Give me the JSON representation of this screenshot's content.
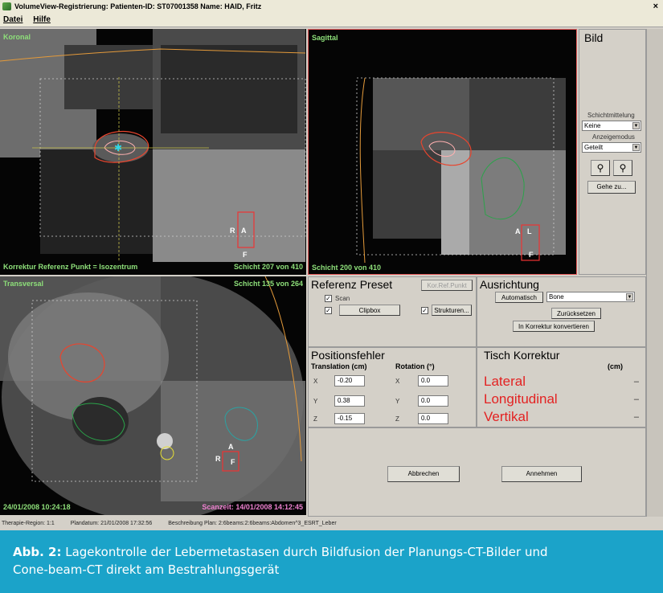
{
  "window": {
    "title": "VolumeView-Registrierung: Patienten-ID: ST07001358  Name: HAID, Fritz",
    "close_glyph": "×"
  },
  "menu": {
    "items": [
      "Datei",
      "Hilfe"
    ]
  },
  "views": {
    "koronal": {
      "name": "Koronal",
      "footer_left": "Korrektur Referenz Punkt = Isozentrum",
      "footer_right": "Schicht 207 von 410",
      "markers": [
        "R",
        "A",
        "F"
      ]
    },
    "sagittal": {
      "name": "Sagittal",
      "footer_left": "Schicht 200 von 410",
      "markers": [
        "A",
        "L",
        "F"
      ]
    },
    "transversal": {
      "name": "Transversal",
      "header_right": "Schicht 135 von 264",
      "footer_left": "24/01/2008 10:24:18",
      "footer_right": "Scanzeit: 14/01/2008 14:12:45",
      "markers": [
        "A",
        "R",
        "F"
      ]
    }
  },
  "bild": {
    "title": "Bild",
    "schichtmittelung_label": "Schichtmittelung",
    "schichtmittelung_value": "Keine",
    "anzeigemodus_label": "Anzeigemodus",
    "anzeigemodus_value": "Geteilt",
    "goto_label": "Gehe zu..."
  },
  "referenz": {
    "title": "Referenz Preset",
    "korr_button": "Kor.Ref.Punkt",
    "scan_label": "Scan",
    "clipbox_label": "Clipbox",
    "strukturen_label": "Strukturen..."
  },
  "ausrichtung": {
    "title": "Ausrichtung",
    "auto_button": "Automatisch",
    "mode_value": "Bone",
    "reset_button": "Zurücksetzen",
    "convert_button": "In Korrektur konvertieren"
  },
  "positionsfehler": {
    "title": "Positionsfehler",
    "translation_header": "Translation (cm)",
    "rotation_header": "Rotation (°)",
    "axes": [
      "X",
      "Y",
      "Z"
    ],
    "translation_values": [
      "-0.20",
      "0.38",
      "-0.15"
    ],
    "rotation_values": [
      "0.0",
      "0.0",
      "0.0"
    ]
  },
  "tisch": {
    "title": "Tisch Korrektur",
    "unit": "(cm)",
    "rows": [
      {
        "label": "Lateral",
        "value": "–"
      },
      {
        "label": "Longitudinal",
        "value": "–"
      },
      {
        "label": "Vertikal",
        "value": "–"
      }
    ]
  },
  "actions": {
    "cancel": "Abbrechen",
    "accept": "Annehmen"
  },
  "status": {
    "region": "Therapie-Region:  1:1",
    "plandatum": "Plandatum:  21/01/2008 17:32:56",
    "plan": "Beschreibung Plan:  2:6beams:2:6beams:Abdomen^3_ESRT_Leber"
  },
  "caption": {
    "label": "Abb. 2:",
    "line1": "Lagekontrolle der Lebermetastasen durch Bildfusion der Planungs-CT-Bilder und",
    "line2": "Cone-beam-CT direkt am Bestrahlungsgerät"
  },
  "colors": {
    "caption_bg": "#1ba3c9",
    "overlay_text": "#8ee07a",
    "overlay_text_alt": "#ee80d0",
    "correction_red": "#e32222"
  }
}
